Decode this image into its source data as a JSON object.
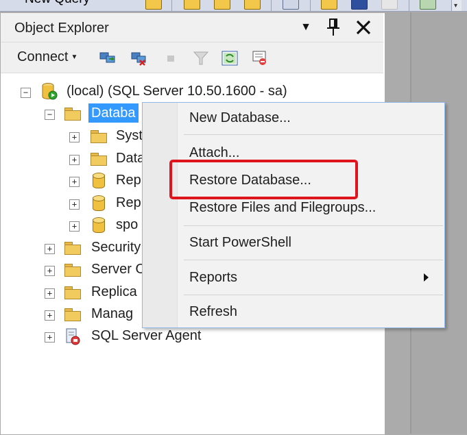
{
  "toolbar": {
    "new_query_label": "New Query",
    "grip_icon": "chevron-down-icon"
  },
  "object_explorer": {
    "title": "Object Explorer",
    "connect_label": "Connect",
    "toolbar_icons": [
      "connect-object-explorer-icon",
      "disconnect-icon",
      "stop-icon",
      "filter-icon",
      "refresh-icon",
      "sync-icon"
    ]
  },
  "tree": {
    "server": {
      "label": "(local) (SQL Server 10.50.1600 - sa)",
      "expander": "−"
    },
    "databases": {
      "label": "Databa",
      "expander": "−"
    },
    "children": [
      {
        "label": "Syst",
        "expander": "+",
        "icon": "folder-icon"
      },
      {
        "label": "Data",
        "expander": "+",
        "icon": "folder-icon"
      },
      {
        "label": "Rep",
        "expander": "+",
        "icon": "database-icon"
      },
      {
        "label": "Rep",
        "expander": "+",
        "icon": "database-icon"
      },
      {
        "label": "spo",
        "expander": "+",
        "icon": "database-icon"
      }
    ],
    "siblings": [
      {
        "label": "Security",
        "expander": "+",
        "icon": "folder-icon"
      },
      {
        "label": "Server O",
        "expander": "+",
        "icon": "folder-icon"
      },
      {
        "label": "Replica",
        "expander": "+",
        "icon": "folder-icon"
      },
      {
        "label": "Manag",
        "expander": "+",
        "icon": "folder-icon"
      },
      {
        "label": "SQL Server Agent",
        "expander": "+",
        "icon": "sql-agent-icon"
      }
    ]
  },
  "context_menu": {
    "items": [
      {
        "label": "New Database..."
      },
      {
        "label": "Attach..."
      },
      {
        "label": "Restore Database..."
      },
      {
        "label": "Restore Files and Filegroups..."
      },
      {
        "label": "Start PowerShell"
      },
      {
        "label": "Reports"
      },
      {
        "label": "Refresh"
      }
    ]
  },
  "colors": {
    "selection": "#3399ff",
    "highlight_box": "#e0141c",
    "menu_border": "#8fb8e8"
  }
}
